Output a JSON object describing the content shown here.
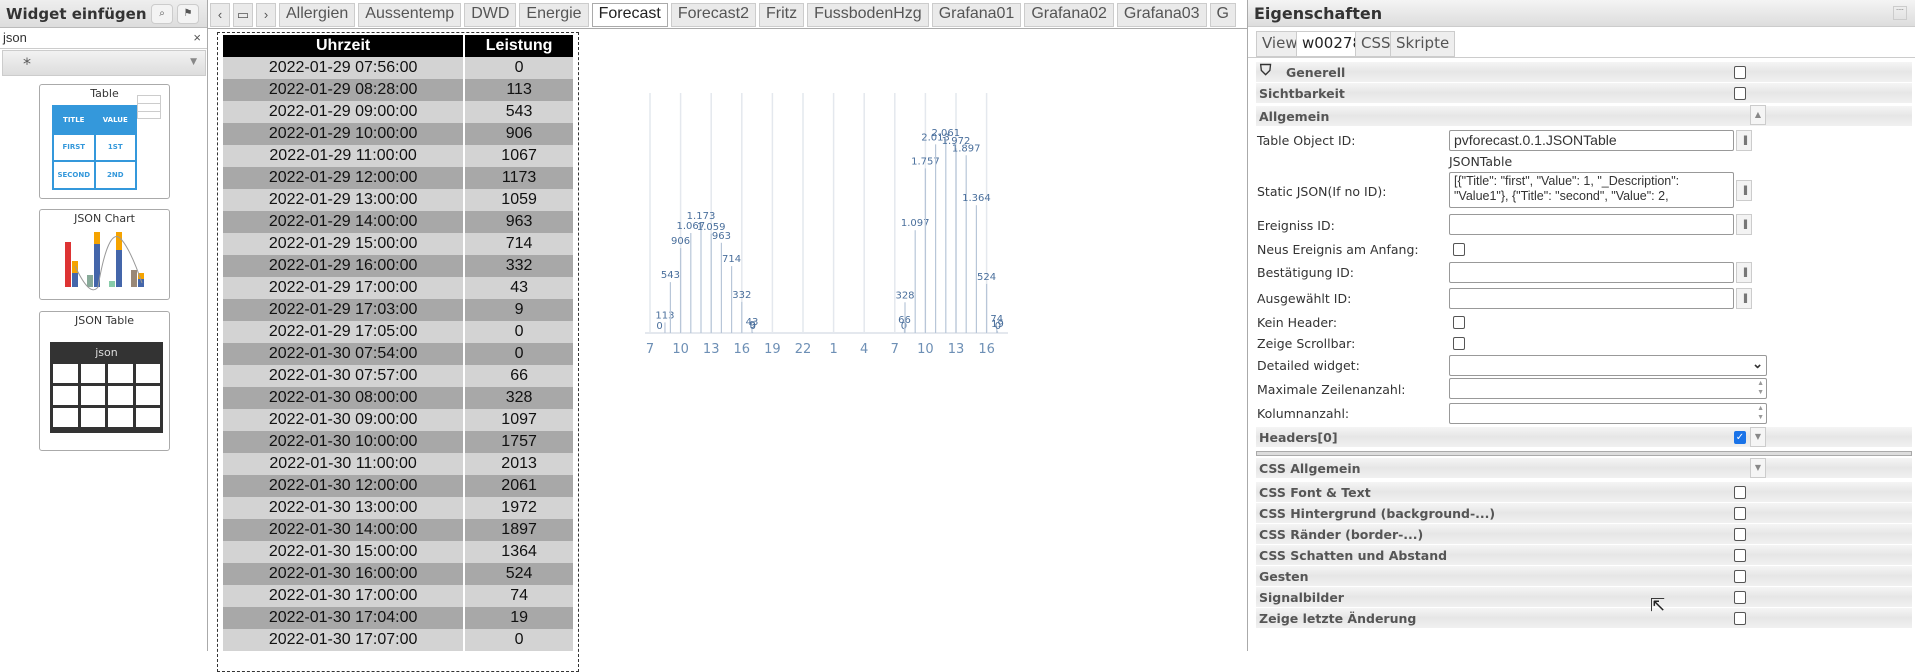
{
  "left": {
    "title": "Widget einfügen",
    "search_value": "json",
    "filter": "*",
    "widgets": [
      {
        "title": "Table",
        "header": [
          "TITLE",
          "VALUE"
        ],
        "rows": [
          [
            "FIRST",
            "1ST"
          ],
          [
            "SECOND",
            "2ND"
          ]
        ]
      },
      {
        "title": "JSON Chart"
      },
      {
        "title": "JSON Table",
        "header": "json"
      }
    ]
  },
  "tabs": [
    "Allergien",
    "Aussentemp",
    "DWD",
    "Energie",
    "Forecast",
    "Forecast2",
    "Fritz",
    "FussbodenHzg",
    "Grafana01",
    "Grafana02",
    "Grafana03",
    "G"
  ],
  "selected_tab": "Forecast",
  "table": {
    "headers": [
      "Uhrzeit",
      "Leistung"
    ],
    "rows": [
      [
        "2022-01-29 07:56:00",
        "0"
      ],
      [
        "2022-01-29 08:28:00",
        "113"
      ],
      [
        "2022-01-29 09:00:00",
        "543"
      ],
      [
        "2022-01-29 10:00:00",
        "906"
      ],
      [
        "2022-01-29 11:00:00",
        "1067"
      ],
      [
        "2022-01-29 12:00:00",
        "1173"
      ],
      [
        "2022-01-29 13:00:00",
        "1059"
      ],
      [
        "2022-01-29 14:00:00",
        "963"
      ],
      [
        "2022-01-29 15:00:00",
        "714"
      ],
      [
        "2022-01-29 16:00:00",
        "332"
      ],
      [
        "2022-01-29 17:00:00",
        "43"
      ],
      [
        "2022-01-29 17:03:00",
        "9"
      ],
      [
        "2022-01-29 17:05:00",
        "0"
      ],
      [
        "2022-01-30 07:54:00",
        "0"
      ],
      [
        "2022-01-30 07:57:00",
        "66"
      ],
      [
        "2022-01-30 08:00:00",
        "328"
      ],
      [
        "2022-01-30 09:00:00",
        "1097"
      ],
      [
        "2022-01-30 10:00:00",
        "1757"
      ],
      [
        "2022-01-30 11:00:00",
        "2013"
      ],
      [
        "2022-01-30 12:00:00",
        "2061"
      ],
      [
        "2022-01-30 13:00:00",
        "1972"
      ],
      [
        "2022-01-30 14:00:00",
        "1897"
      ],
      [
        "2022-01-30 15:00:00",
        "1364"
      ],
      [
        "2022-01-30 16:00:00",
        "524"
      ],
      [
        "2022-01-30 17:00:00",
        "74"
      ],
      [
        "2022-01-30 17:04:00",
        "19"
      ],
      [
        "2022-01-30 17:07:00",
        "0"
      ]
    ]
  },
  "chart_data": {
    "type": "bar",
    "x": [
      "2022-01-29 07:56",
      "2022-01-29 08:28",
      "2022-01-29 09:00",
      "2022-01-29 10:00",
      "2022-01-29 11:00",
      "2022-01-29 12:00",
      "2022-01-29 13:00",
      "2022-01-29 14:00",
      "2022-01-29 15:00",
      "2022-01-29 16:00",
      "2022-01-29 17:00",
      "2022-01-29 17:03",
      "2022-01-29 17:05",
      "2022-01-30 07:54",
      "2022-01-30 07:57",
      "2022-01-30 08:00",
      "2022-01-30 09:00",
      "2022-01-30 10:00",
      "2022-01-30 11:00",
      "2022-01-30 12:00",
      "2022-01-30 13:00",
      "2022-01-30 14:00",
      "2022-01-30 15:00",
      "2022-01-30 16:00",
      "2022-01-30 17:00",
      "2022-01-30 17:04",
      "2022-01-30 17:07"
    ],
    "values": [
      0,
      113,
      543,
      906,
      1067,
      1173,
      1059,
      963,
      714,
      332,
      43,
      9,
      0,
      0,
      66,
      328,
      1097,
      1757,
      2013,
      2061,
      1972,
      1897,
      1364,
      524,
      74,
      19,
      0
    ],
    "data_labels": [
      "0",
      "113",
      "543",
      "906",
      "1.067",
      "1.173",
      "1.059",
      "963",
      "714",
      "332",
      "43",
      "9",
      "0",
      "0",
      "66",
      "328",
      "1.097",
      "1.757",
      "2.013",
      "2.061",
      "1.972",
      "1.897",
      "1.364",
      "524",
      "74",
      "19",
      "0"
    ],
    "x_ticks": [
      "7",
      "10",
      "13",
      "16",
      "19",
      "22",
      "1",
      "4",
      "7",
      "10",
      "13",
      "16"
    ],
    "xlim": [
      "2022-01-29 07:00",
      "2022-01-30 18:00"
    ],
    "ylim": [
      0,
      2400
    ],
    "grid": "vertical",
    "color": "#4a6f9c"
  },
  "right": {
    "title": "Eigenschaften",
    "tabs": [
      "View",
      "w00278",
      "CSS",
      "Skripte"
    ],
    "selected_tab": "w00278",
    "sections": {
      "generell": "Generell",
      "sichtbarkeit": "Sichtbarkeit",
      "allgemein": "Allgemein",
      "headers": "Headers[0]",
      "css_allgemein": "CSS Allgemein"
    },
    "fields": {
      "table_object_id": {
        "label": "Table Object ID:",
        "value": "pvforecast.0.1.JSONTable",
        "hint": "JSONTable"
      },
      "static_json": {
        "label": "Static JSON(If no ID):",
        "value": "[{\"Title\": \"first\", \"Value\": 1, \"_Description\": \"Value1\"}, {\"Title\": \"second\", \"Value\": 2,"
      },
      "ereigniss_id": {
        "label": "Ereigniss ID:",
        "value": ""
      },
      "neus_ereignis": {
        "label": "Neus Ereignis am Anfang:",
        "checked": false
      },
      "bestaetigung_id": {
        "label": "Bestätigung ID:",
        "value": ""
      },
      "ausgewaehlt_id": {
        "label": "Ausgewählt ID:",
        "value": ""
      },
      "kein_header": {
        "label": "Kein Header:",
        "checked": false
      },
      "zeige_scrollbar": {
        "label": "Zeige Scrollbar:",
        "checked": false
      },
      "detailed_widget": {
        "label": "Detailed widget:",
        "value": ""
      },
      "max_zeilen": {
        "label": "Maximale Zeilenanzahl:",
        "value": ""
      },
      "kolumnanzahl": {
        "label": "Kolumnanzahl:",
        "value": ""
      }
    },
    "css_groups": [
      "CSS Font & Text",
      "CSS Hintergrund (background-...)",
      "CSS Ränder (border-...)",
      "CSS Schatten und Abstand",
      "Gesten",
      "Signalbilder",
      "Zeige letzte Änderung"
    ]
  }
}
